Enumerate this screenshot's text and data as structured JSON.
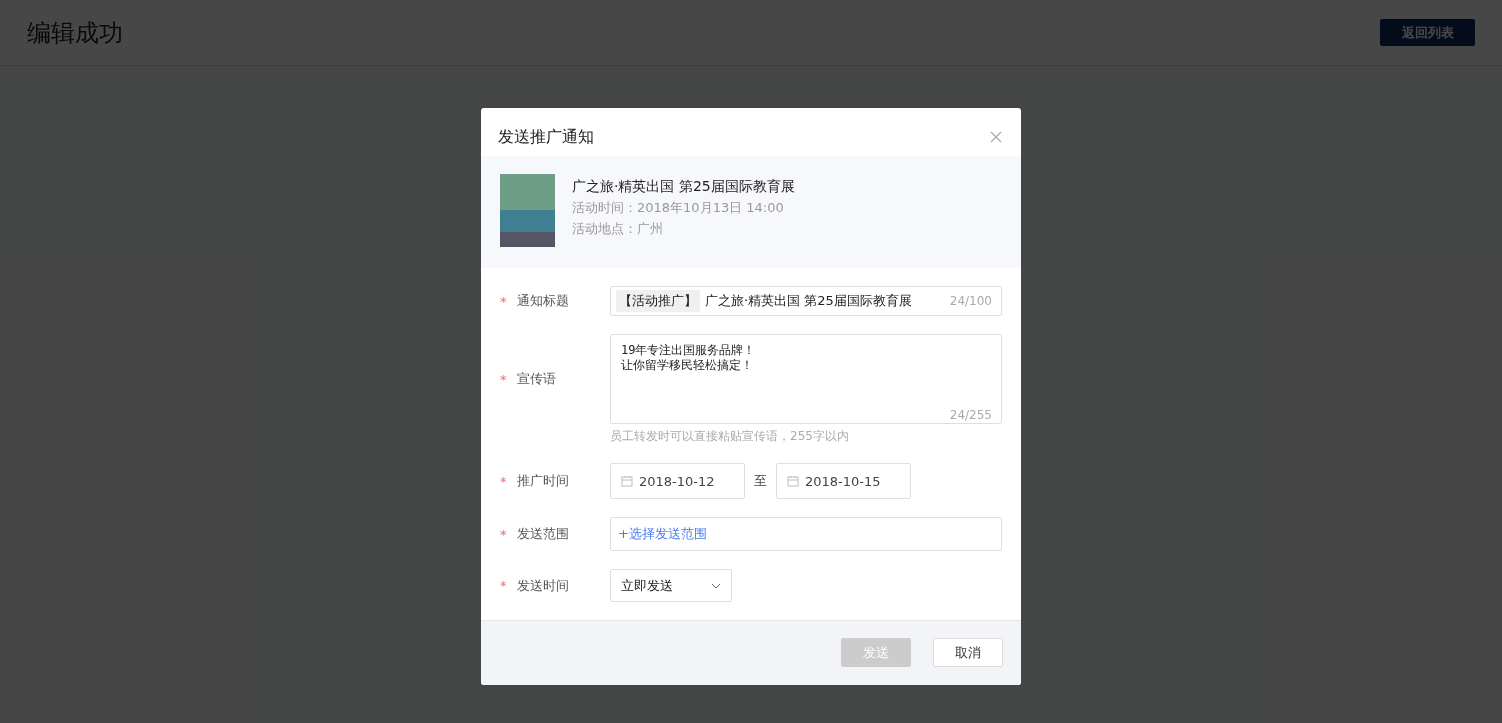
{
  "page": {
    "title": "编辑成功",
    "back_button": {
      "label": "返回列表"
    }
  },
  "dialog": {
    "title": "发送推广通知",
    "event": {
      "name": "广之旅·精英出国 第25届国际教育展",
      "time": "活动时间：2018年10月13日 14:00",
      "place": "活动地点：广州"
    },
    "fields": [
      {
        "kind": "text",
        "label": "通知标题",
        "mark": "*",
        "tag": "【活动推广】",
        "value": "广之旅·精英出国 第25届国际教育展",
        "count": "24/100"
      },
      {
        "kind": "textarea",
        "label": "宣传语",
        "mark": "*",
        "lines": [
          "19年专注出国服务品牌！",
          "让你留学移民轻松搞定！"
        ],
        "count": "24/255",
        "hint": "员工转发时可以直接粘贴宣传语，255字以内"
      },
      {
        "kind": "daterange",
        "label": "推广时间",
        "mark": "*",
        "start": "2018-10-12",
        "separator": "至",
        "end": "2018-10-15"
      },
      {
        "kind": "picker",
        "label": "发送范围",
        "mark": "*",
        "link": "+选择发送范围"
      },
      {
        "kind": "select",
        "label": "发送时间",
        "mark": "*",
        "value": "立即发送"
      }
    ],
    "buttons": [
      {
        "label": "发送",
        "disabled": true
      },
      {
        "label": "取消",
        "disabled": false
      }
    ]
  }
}
